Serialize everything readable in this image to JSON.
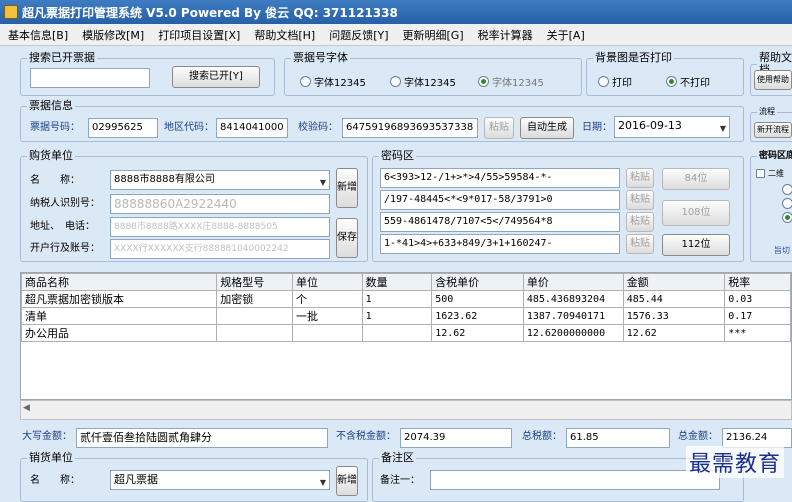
{
  "window": {
    "title": "超凡票据打印管理系统 V5.0 Powered By 俊云 QQ: 371121338"
  },
  "menu": [
    "基本信息[B]",
    "模版修改[M]",
    "打印项目设置[X]",
    "帮助文档[H]",
    "问题反馈[Y]",
    "更新明细[G]",
    "税率计算器",
    "关于[A]"
  ],
  "search": {
    "legend": "搜索已开票据",
    "input": "",
    "button": "搜索已开[Y]"
  },
  "font_group": {
    "legend": "票据号字体",
    "options": [
      "字体12345",
      "字体12345",
      "字体12345"
    ],
    "selected": 2
  },
  "bg_group": {
    "legend": "背景图是否打印",
    "options": [
      "打印",
      "不打印"
    ],
    "selected": 1
  },
  "help_group": {
    "legend": "帮助文档",
    "button": "使用帮助"
  },
  "invoice": {
    "legend": "票据信息",
    "no_label": "票据号码：",
    "no_value": "02995625",
    "area_label": "地区代码：",
    "area_value": "8414041000",
    "check_label": "校验码：",
    "check_value": "64759196893693537338",
    "paste": "粘贴",
    "auto": "自动生成",
    "date_label": "日期：",
    "date_value": "2016-09-13"
  },
  "flow": {
    "legend": "流程",
    "button": "新开流程"
  },
  "buyer": {
    "legend": "购货单位",
    "name_label": "名　　称：",
    "name_value": "8888市8888有限公司",
    "taxid_label": "纳税人识别号：",
    "taxid_value": "88888860A2922440",
    "addr_label": "地址、　电话：",
    "addr_value": "8888市8888路XXXX庄8888-8888505",
    "bank_label": "开户行及账号：",
    "bank_value": "XXXX行XXXXXX支行888881040002242",
    "new_btn": "新增",
    "save_btn": "保存"
  },
  "cipher": {
    "legend": "密码区",
    "lines": [
      "6<393>12-/1+>*>4/55>59584-*-",
      "/197-48445<*<9*017-58/3791>0",
      "559-4861478/7107<5</749564*8",
      "1-*41>4>+633+849/3+1+160247-"
    ],
    "paste": "粘贴",
    "btn_84": "84位",
    "btn_108": "108位",
    "btn_112": "112位"
  },
  "cipher_right": {
    "legend": "密码区底",
    "opt1": "二维",
    "link": "旨切"
  },
  "table": {
    "headers": [
      "商品名称",
      "规格型号",
      "单位",
      "数量",
      "含税单价",
      "单价",
      "金额",
      "税率"
    ],
    "rows": [
      [
        "超凡票据加密锁版本",
        "加密锁",
        "个",
        "1",
        "500",
        "485.436893204",
        "485.44",
        "0.03"
      ],
      [
        "清单",
        "",
        "一批",
        "1",
        "1623.62",
        "1387.70940171",
        "1576.33",
        "0.17"
      ],
      [
        "办公用品",
        "",
        "",
        "",
        "12.62",
        "12.6200000000",
        "12.62",
        "***"
      ]
    ]
  },
  "totals": {
    "capital_label": "大写金额：",
    "capital_value": "贰仟壹佰叁拾陆圆贰角肆分",
    "notax_label": "不含税金额：",
    "notax_value": "2074.39",
    "tax_label": "总税额：",
    "tax_value": "61.85",
    "total_label": "总金额：",
    "total_value": "2136.24"
  },
  "seller": {
    "legend": "销货单位",
    "name_label": "名　　称：",
    "name_value": "超凡票据",
    "new_btn": "新增"
  },
  "remark": {
    "legend": "备注区",
    "label1": "备注一："
  },
  "watermark": "最需教育"
}
